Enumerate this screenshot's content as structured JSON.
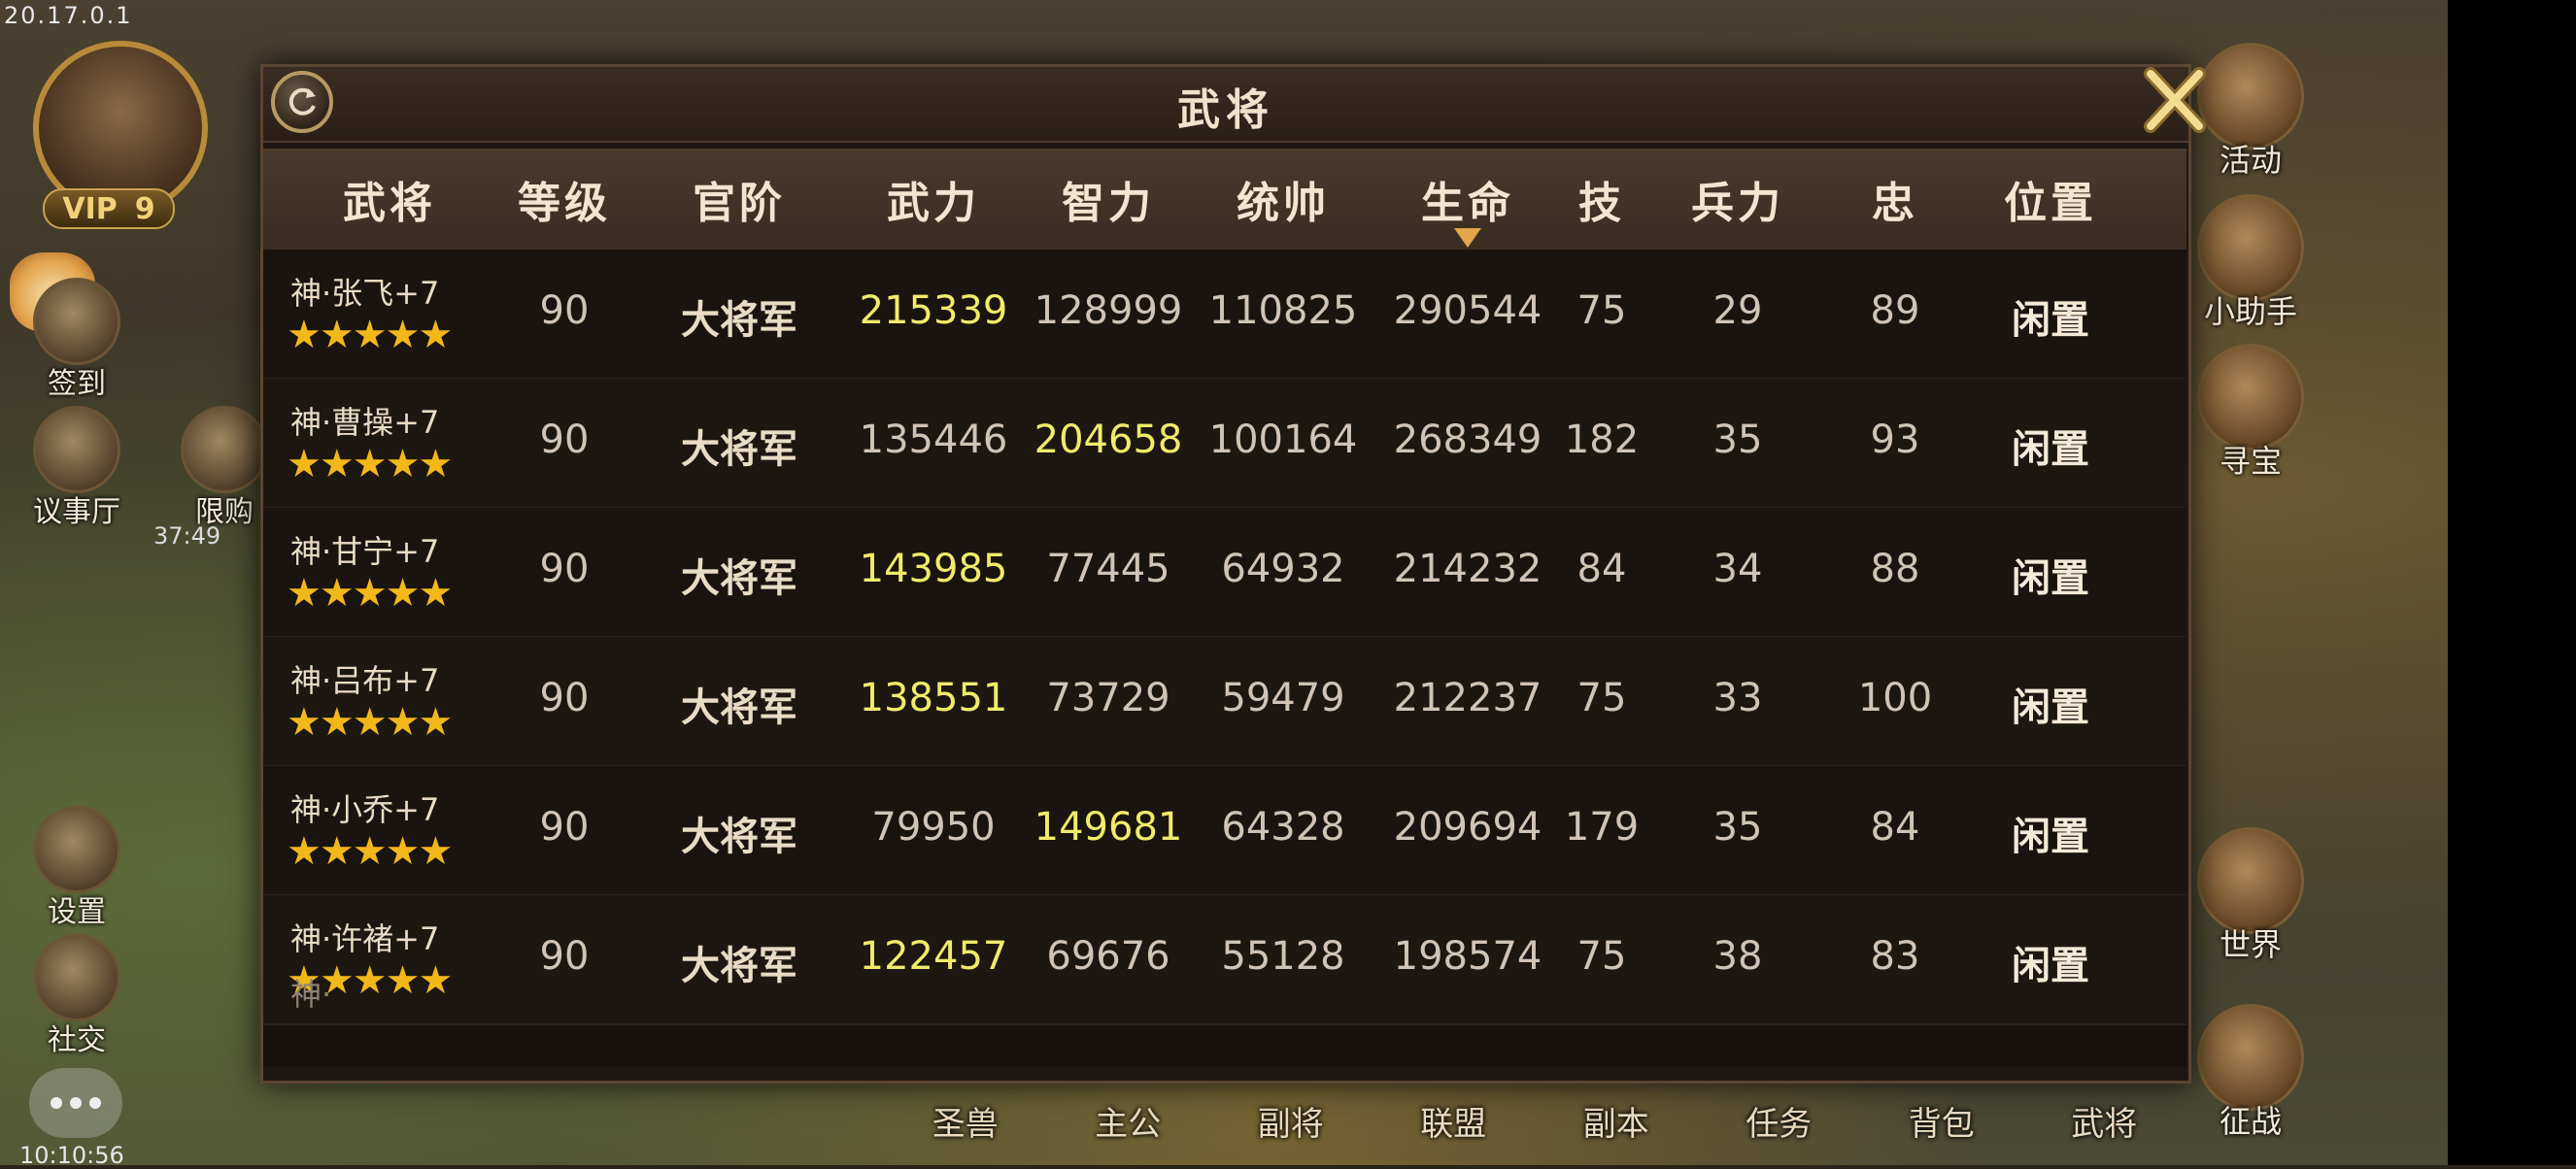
{
  "system": {
    "version": "20.17.0.1",
    "clock": "10:10:56"
  },
  "player": {
    "vip_label": "VIP",
    "vip_level": "9"
  },
  "left_menu": [
    {
      "label": "签到",
      "icon": "sign-in-icon"
    },
    {
      "label": "议事厅",
      "icon": "council-hall-icon"
    },
    {
      "label": "限购",
      "icon": "limited-buy-icon"
    },
    {
      "label": "设置",
      "icon": "gear-icon"
    },
    {
      "label": "社交",
      "icon": "social-icon"
    }
  ],
  "left_timer": "37:49",
  "right_menu": [
    {
      "label": "活动",
      "icon": "gift-box-icon"
    },
    {
      "label": "小助手",
      "icon": "scroll-icon"
    },
    {
      "label": "寻宝",
      "icon": "treasure-chest-icon"
    },
    {
      "label": "世界",
      "icon": "dragon-world-icon"
    },
    {
      "label": "征战",
      "icon": "dragon-battle-icon"
    }
  ],
  "bottom_nav": [
    "圣兽",
    "主公",
    "副将",
    "联盟",
    "副本",
    "任务",
    "背包",
    "武将"
  ],
  "dialog": {
    "title": "武将",
    "columns": [
      "武将",
      "等级",
      "官阶",
      "武力",
      "智力",
      "统帅",
      "生命",
      "技",
      "兵力",
      "忠",
      "位置"
    ],
    "sorted_column": "生命",
    "rows": [
      {
        "name": "神·张飞+7",
        "stars": "★★★★★",
        "level": "90",
        "rank": "大将军",
        "force": "215339",
        "intel": "128999",
        "command": "110825",
        "life": "290544",
        "skill": "75",
        "troops": "29",
        "loyalty": "89",
        "position": "闲置",
        "highlight": "force"
      },
      {
        "name": "神·曹操+7",
        "stars": "★★★★★",
        "level": "90",
        "rank": "大将军",
        "force": "135446",
        "intel": "204658",
        "command": "100164",
        "life": "268349",
        "skill": "182",
        "troops": "35",
        "loyalty": "93",
        "position": "闲置",
        "highlight": "intel"
      },
      {
        "name": "神·甘宁+7",
        "stars": "★★★★★",
        "level": "90",
        "rank": "大将军",
        "force": "143985",
        "intel": "77445",
        "command": "64932",
        "life": "214232",
        "skill": "84",
        "troops": "34",
        "loyalty": "88",
        "position": "闲置",
        "highlight": "force"
      },
      {
        "name": "神·吕布+7",
        "stars": "★★★★★",
        "level": "90",
        "rank": "大将军",
        "force": "138551",
        "intel": "73729",
        "command": "59479",
        "life": "212237",
        "skill": "75",
        "troops": "33",
        "loyalty": "100",
        "position": "闲置",
        "highlight": "force"
      },
      {
        "name": "神·小乔+7",
        "stars": "★★★★★",
        "level": "90",
        "rank": "大将军",
        "force": "79950",
        "intel": "149681",
        "command": "64328",
        "life": "209694",
        "skill": "179",
        "troops": "35",
        "loyalty": "84",
        "position": "闲置",
        "highlight": "intel"
      },
      {
        "name": "神·许褚+7",
        "stars": "★★★★★",
        "level": "90",
        "rank": "大将军",
        "force": "122457",
        "intel": "69676",
        "command": "55128",
        "life": "198574",
        "skill": "75",
        "troops": "38",
        "loyalty": "83",
        "position": "闲置",
        "highlight": "force"
      }
    ]
  },
  "colors": {
    "highlight_stat": "#f0ec6a",
    "star": "#f2b81a",
    "sort_arrow": "#e3a64a"
  }
}
